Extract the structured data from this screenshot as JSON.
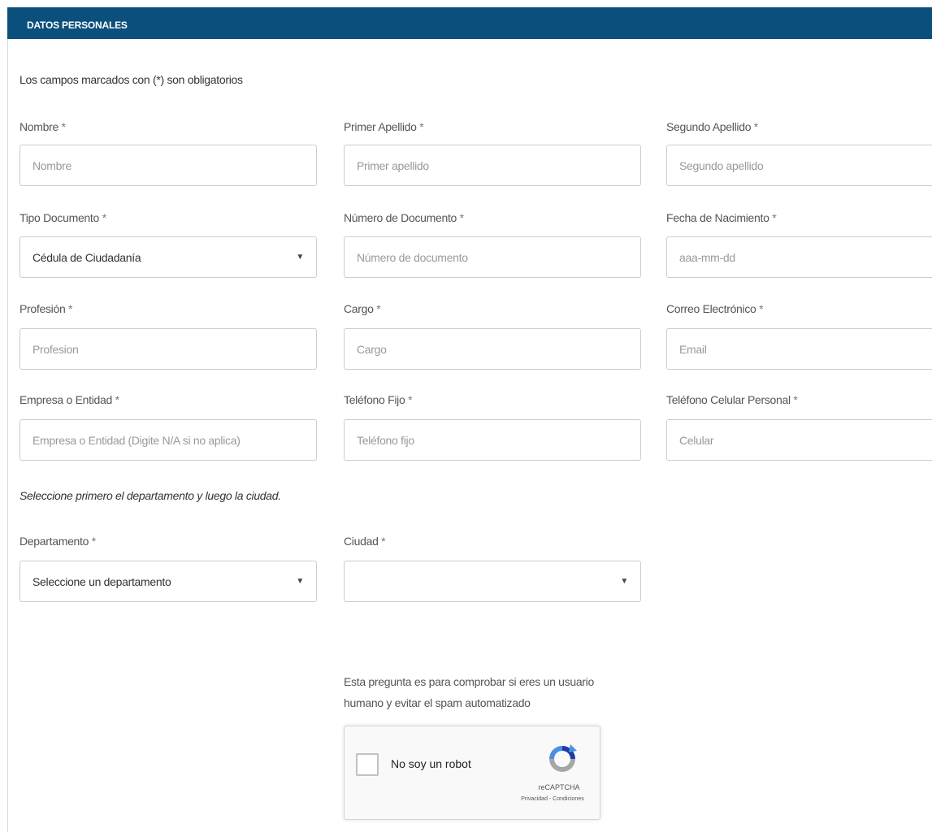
{
  "header": {
    "title": "DATOS PERSONALES"
  },
  "form": {
    "required_note": "Los campos marcados con (*) son obligatorios",
    "location_hint": "Seleccione primero el departamento y luego la ciudad.",
    "fields": {
      "nombre": {
        "label": "Nombre",
        "req": "*",
        "placeholder": "Nombre"
      },
      "primer_apellido": {
        "label": "Primer Apellido",
        "req": "*",
        "placeholder": "Primer apellido"
      },
      "segundo_apellido": {
        "label": "Segundo Apellido",
        "req": "*",
        "placeholder": "Segundo apellido"
      },
      "tipo_documento": {
        "label": "Tipo Documento",
        "req": "*",
        "value": "Cédula de Ciudadanía"
      },
      "numero_documento": {
        "label": "Número de Documento",
        "req": "*",
        "placeholder": "Número de documento"
      },
      "fecha_nacimiento": {
        "label": "Fecha de Nacimiento",
        "req": "*",
        "placeholder": "aaa-mm-dd"
      },
      "profesion": {
        "label": "Profesión",
        "req": "*",
        "placeholder": "Profesion"
      },
      "cargo": {
        "label": "Cargo",
        "req": "*",
        "placeholder": "Cargo"
      },
      "correo": {
        "label": "Correo Electrónico",
        "req": "*",
        "placeholder": "Email"
      },
      "empresa": {
        "label": "Empresa o Entidad",
        "req": "*",
        "placeholder": "Empresa o Entidad (Digite N/A si no aplica)"
      },
      "telefono_fijo": {
        "label": "Teléfono Fijo",
        "req": "*",
        "placeholder": "Teléfono fijo"
      },
      "celular": {
        "label": "Teléfono Celular Personal",
        "req": "*",
        "placeholder": "Celular"
      },
      "departamento": {
        "label": "Departamento",
        "req": "*",
        "value": "Seleccione un departamento"
      },
      "ciudad": {
        "label": "Ciudad",
        "req": "*",
        "value": ""
      }
    }
  },
  "captcha": {
    "question": "Esta pregunta es para comprobar si eres un usuario humano y evitar el spam automatizado",
    "checkbox_label": "No soy un robot",
    "brand": "reCAPTCHA",
    "links": "Privacidad - Condiciones"
  },
  "icons": {
    "dropdown": "chevron-down-icon",
    "captcha_logo": "recaptcha-logo-icon"
  },
  "colors": {
    "header_bg": "#0b4f7c",
    "header_text": "#ffffff",
    "border": "#cccccc"
  }
}
